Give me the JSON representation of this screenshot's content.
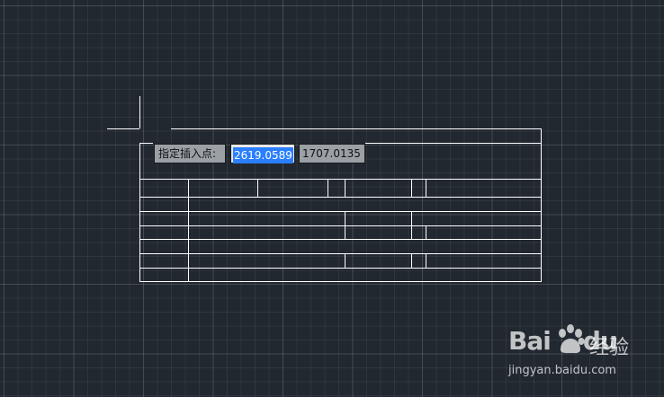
{
  "prompt": {
    "label": "指定插入点:",
    "x_value": "2619.0589",
    "y_value": "1707.0135"
  },
  "watermark": {
    "logo_left": "Bai",
    "logo_right": "du",
    "word": "经验",
    "url": "jingyan.baidu.com"
  },
  "icons": {
    "crosshair": "crosshair-cursor-icon",
    "paw": "baidu-paw-icon"
  },
  "colors": {
    "background": "#212830",
    "line": "#ffffff",
    "selection": "#2a7fff"
  }
}
